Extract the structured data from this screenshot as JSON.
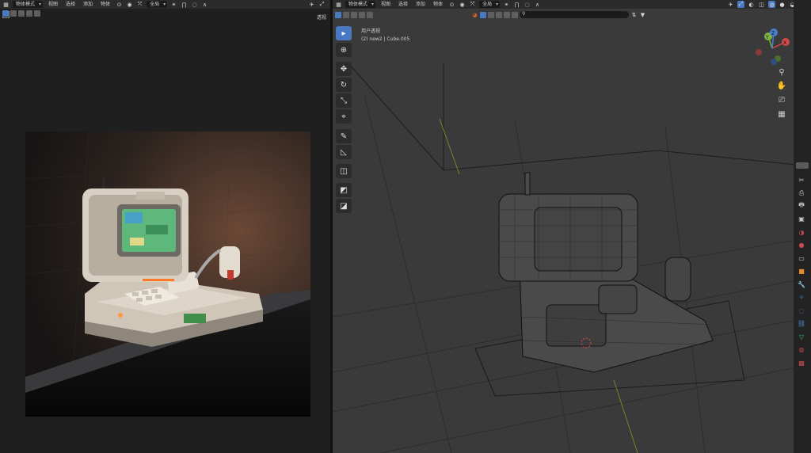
{
  "left": {
    "header": {
      "mode": "物体模式",
      "menus": [
        "视图",
        "选择",
        "添加",
        "物体"
      ],
      "transform": "全局"
    },
    "options_label": "透视",
    "render_image": "rendered portable game console on dark pedestal"
  },
  "right": {
    "header": {
      "mode": "物体模式",
      "menus": [
        "视图",
        "选择",
        "添加",
        "物体"
      ],
      "transform": "全局"
    },
    "options_label": "选项",
    "viewport": {
      "view_name": "用户透视",
      "object_info": "(2) new2 | Cube.005"
    },
    "gizmo": {
      "x": "X",
      "y": "Y",
      "z": "Z"
    },
    "toolbar": [
      {
        "name": "select-box-tool",
        "icon": "▸",
        "active": true
      },
      {
        "name": "cursor-tool",
        "icon": "⊕"
      },
      {
        "name": "move-tool",
        "icon": "✥"
      },
      {
        "name": "rotate-tool",
        "icon": "↻"
      },
      {
        "name": "scale-tool",
        "icon": "⤡"
      },
      {
        "name": "transform-tool",
        "icon": "⌖"
      },
      {
        "name": "annotate-tool",
        "icon": "✎"
      },
      {
        "name": "measure-tool",
        "icon": "📐"
      },
      {
        "name": "add-cube-tool",
        "icon": "◫"
      },
      {
        "name": "extrude-tool",
        "icon": "◩"
      },
      {
        "name": "knife-tool",
        "icon": "◪"
      }
    ],
    "nav_icons": [
      "zoom-icon",
      "hand-icon",
      "camera-icon",
      "grid-icon"
    ],
    "property_tabs": [
      {
        "name": "tool-tab",
        "color": "#c8c8c8"
      },
      {
        "name": "render-tab",
        "color": "#c8c8c8"
      },
      {
        "name": "output-tab",
        "color": "#c8c8c8"
      },
      {
        "name": "view-layer-tab",
        "color": "#c8c8c8"
      },
      {
        "name": "scene-tab",
        "color": "#c44c4c"
      },
      {
        "name": "world-tab",
        "color": "#c44c4c"
      },
      {
        "name": "collection-tab",
        "color": "#c8c8c8"
      },
      {
        "name": "object-tab",
        "color": "#e58a28"
      },
      {
        "name": "modifier-tab",
        "color": "#4f8fd8"
      },
      {
        "name": "particles-tab",
        "color": "#4f8fd8"
      },
      {
        "name": "physics-tab",
        "color": "#4f8fd8"
      },
      {
        "name": "constraints-tab",
        "color": "#4f8fd8"
      },
      {
        "name": "data-tab",
        "color": "#3fbf5c"
      },
      {
        "name": "material-tab",
        "color": "#c44c4c"
      },
      {
        "name": "texture-tab",
        "color": "#c44c4c"
      }
    ]
  }
}
